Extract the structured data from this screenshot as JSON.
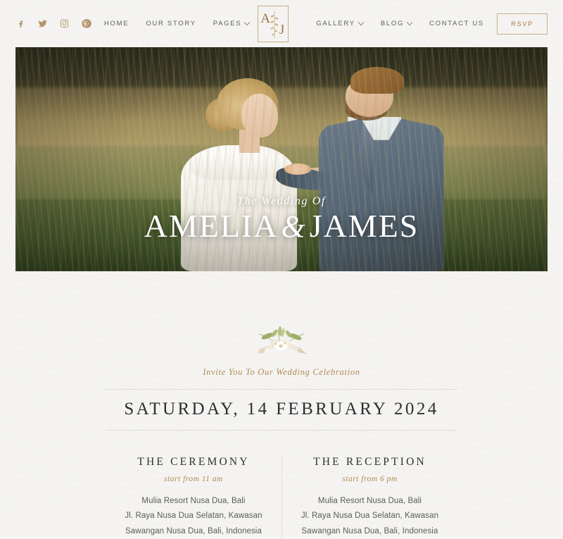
{
  "header": {
    "social": [
      {
        "name": "facebook-icon",
        "label": "Facebook"
      },
      {
        "name": "twitter-icon",
        "label": "Twitter"
      },
      {
        "name": "instagram-icon",
        "label": "Instagram"
      },
      {
        "name": "pinterest-icon",
        "label": "Pinterest"
      }
    ],
    "nav_left": [
      {
        "label": "HOME",
        "has_dropdown": false
      },
      {
        "label": "OUR STORY",
        "has_dropdown": false
      },
      {
        "label": "PAGES",
        "has_dropdown": true
      }
    ],
    "nav_right": [
      {
        "label": "GALLERY",
        "has_dropdown": true
      },
      {
        "label": "BLOG",
        "has_dropdown": true
      },
      {
        "label": "CONTACT US",
        "has_dropdown": false
      }
    ],
    "logo": {
      "initial_left": "A",
      "initial_right": "J"
    },
    "rsvp_label": "RSVP"
  },
  "hero": {
    "pre_title": "The Wedding Of",
    "bride_name": "AMELIA",
    "ampersand": "&",
    "groom_name": "JAMES"
  },
  "invite": {
    "tagline": "Invite You To Our Wedding Celebration",
    "date": "SATURDAY, 14 FEBRUARY 2024"
  },
  "events": [
    {
      "title": "THE CEREMONY",
      "time": "start from 11 am",
      "address": [
        "Mulia Resort Nusa Dua, Bali",
        "Jl. Raya Nusa Dua Selatan, Kawasan",
        "Sawangan Nusa Dua, Bali, Indonesia"
      ]
    },
    {
      "title": "THE RECEPTION",
      "time": "start from 6 pm",
      "address": [
        "Mulia Resort Nusa Dua, Bali",
        "Jl. Raya Nusa Dua Selatan, Kawasan",
        "Sawangan Nusa Dua, Bali, Indonesia"
      ]
    }
  ],
  "colors": {
    "background": "#f5f4f2",
    "gold": "#b08b56",
    "gold_light": "#cbae8b",
    "text_dark": "#2e2e2e",
    "text_body": "#5a5a5a",
    "nav_text": "#5d5d5d"
  }
}
